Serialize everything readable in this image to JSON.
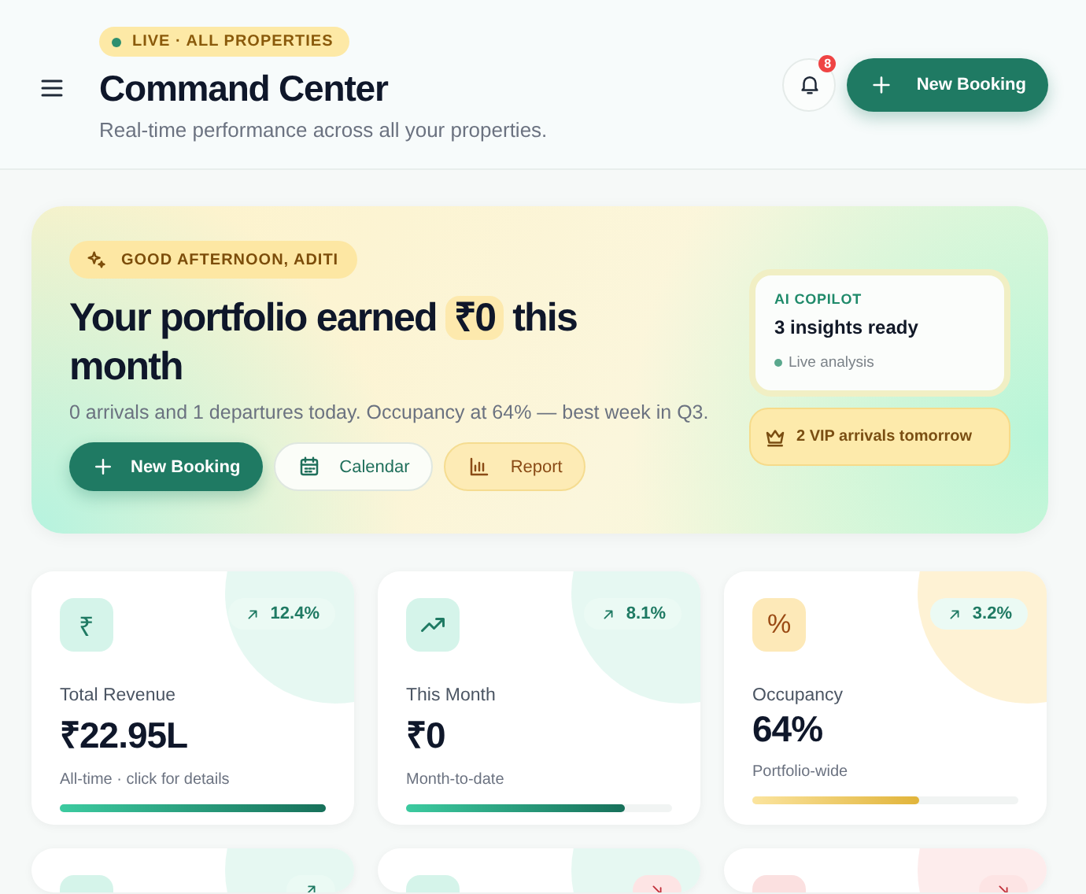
{
  "header": {
    "live_badge": "LIVE · ALL PROPERTIES",
    "title": "Command Center",
    "subtitle": "Real-time performance across all your properties.",
    "notification_count": "8",
    "new_booking": "New Booking"
  },
  "hero": {
    "greeting": "GOOD AFTERNOON, ADITI",
    "headline_before": "Your portfolio earned",
    "headline_amount": "₹0",
    "headline_after": "this month",
    "summary": "0 arrivals and 1 departures today. Occupancy at 64% — best week in Q3.",
    "actions": [
      {
        "kind": "primary",
        "label": "New Booking"
      },
      {
        "kind": "calendar",
        "label": "Calendar"
      },
      {
        "kind": "report",
        "label": "Report"
      }
    ],
    "copilot": {
      "eyebrow": "AI COPILOT",
      "title": "3 insights ready",
      "status": "Live analysis"
    },
    "vip": "2 VIP arrivals tomorrow"
  },
  "stats": [
    {
      "kind": "up",
      "color": "#d5f4ea",
      "glyph": "₹",
      "change": "12.4%",
      "label": "Total Revenue",
      "value": "₹22.95L",
      "note": "All-time · click for details",
      "level": 1.0
    },
    {
      "kind": "up",
      "color": "#d5f4ea",
      "change": "8.1%",
      "label": "This Month",
      "value": "₹0",
      "note": "Month-to-date",
      "level": 0.82
    },
    {
      "kind": "up",
      "color": "#fde9b8",
      "glyph": "%",
      "change": "3.2%",
      "label": "Occupancy",
      "value": "64%",
      "note": "Portfolio-wide",
      "level": 0.63
    },
    {
      "kind": "up",
      "color": "#d5f4ea"
    },
    {
      "kind": "down",
      "color": "#d5f4ea"
    },
    {
      "kind": "down",
      "color": "#fbe0e0"
    }
  ]
}
